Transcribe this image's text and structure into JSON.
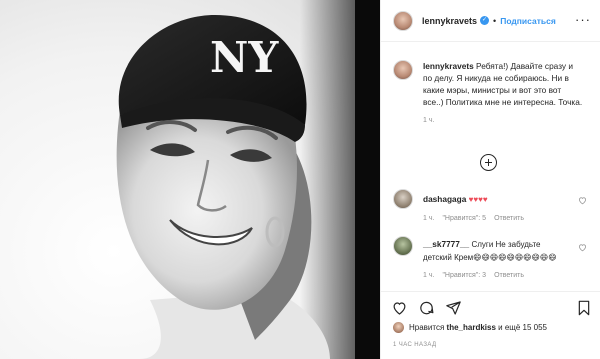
{
  "post": {
    "author": "lennykravets",
    "follow_label": "Подписаться",
    "caption_author": "lennykravets",
    "caption_text": "Ребята!) Давайте сразу и по делу. Я никуда не собираюсь. Ни в какие мэры, министры и вот это вот все..) Политика мне не интересна. Точка.",
    "caption_time": "1 ч."
  },
  "comments": [
    {
      "username": "dashagaga",
      "text": "♥♥♥♥",
      "time": "1 ч.",
      "likes_label": "\"Нравится\": 5",
      "reply_label": "Ответить"
    },
    {
      "username": "__sk7777__",
      "text": "Слуги Не забудьте детский Крем😄😄😄😄😄😄😄😄😄😄",
      "time": "1 ч.",
      "likes_label": "\"Нравится\": 3",
      "reply_label": "Ответить"
    }
  ],
  "footer": {
    "liked_by_prefix": "Нравится",
    "liked_by_user": "the_hardkiss",
    "liked_by_suffix": "и ещё 15 055",
    "timestamp": "1 ЧАС НАЗАД"
  },
  "image": {
    "cap_logo": "NY"
  },
  "colors": {
    "accent": "#3897f0",
    "heart": "#ed4956",
    "muted": "#8e8e8e",
    "text": "#262626",
    "border": "#efefef"
  },
  "icons": [
    "verified-icon",
    "more-options-icon",
    "load-more-comments-icon",
    "like-icon",
    "comment-icon",
    "share-icon",
    "save-icon"
  ]
}
